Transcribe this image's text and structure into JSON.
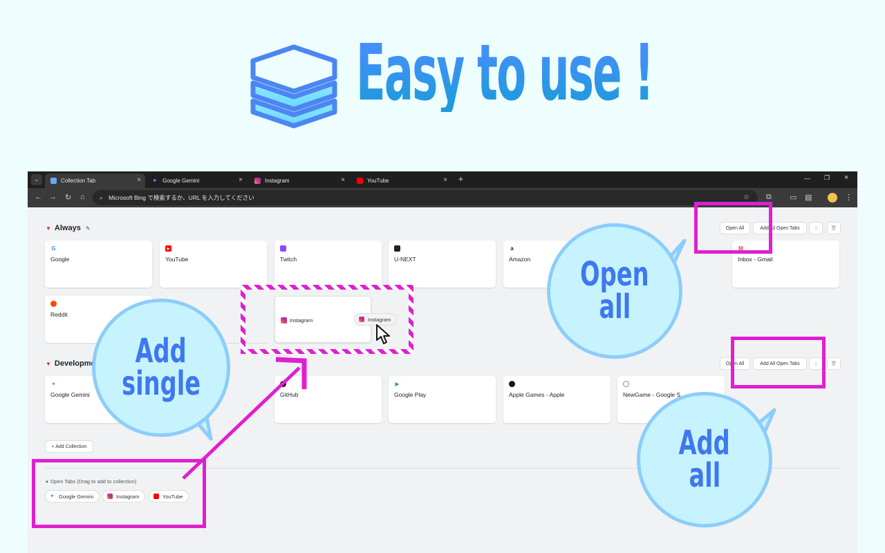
{
  "hero": {
    "title": "Easy to use !"
  },
  "browser": {
    "tabs": [
      {
        "label": "Collection Tab",
        "icon": "collection-tab-icon"
      },
      {
        "label": "Google Gemini",
        "icon": "gemini-icon"
      },
      {
        "label": "Instagram",
        "icon": "instagram-icon"
      },
      {
        "label": "YouTube",
        "icon": "youtube-icon"
      }
    ],
    "omnibox_text": "Microsoft Bing で検索するか、URL を入力してください"
  },
  "collections": [
    {
      "name": "Always",
      "buttons": {
        "open_all": "Open All",
        "add_all": "Add All Open Tabs"
      },
      "items": [
        "Google",
        "YouTube",
        "Twitch",
        "U-NEXT",
        "Amazon",
        "Inbox - Gmail",
        "Reddit"
      ]
    },
    {
      "name": "Developme",
      "buttons": {
        "open_all": "Open All",
        "add_all": "Add All Open Tabs"
      },
      "items": [
        "Google Gemini",
        "GitHub",
        "Google Play",
        "Apple Games - Apple",
        "NewGame - Google S"
      ]
    }
  ],
  "add_collection_label": "+ Add Collection",
  "open_tabs": {
    "header": "Open Tabs (Drag to add to collection)",
    "chips": [
      "Google Gemini",
      "Instagram",
      "YouTube"
    ]
  },
  "drag_demo": {
    "card_label": "Instagram",
    "chip_label": "Instagram"
  },
  "callouts": {
    "open_all": [
      "Open",
      "all"
    ],
    "add_single": [
      "Add",
      "single"
    ],
    "add_all": [
      "Add",
      "all"
    ]
  },
  "colors": {
    "accent": "#e01fd0",
    "bubble_fill": "#c7f3ff",
    "bubble_stroke": "#8ccdfa",
    "bubble_text": "#3f78ee"
  }
}
